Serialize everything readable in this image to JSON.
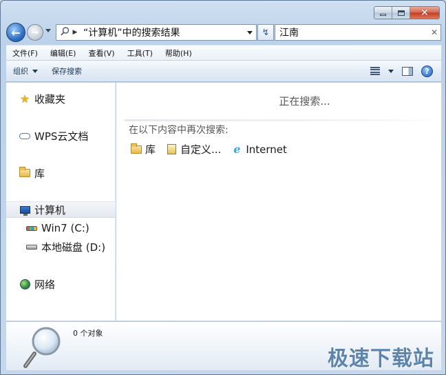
{
  "window": {
    "caption": {
      "minimize": "minimize",
      "maximize": "maximize",
      "close": "✕"
    }
  },
  "navbar": {
    "address_text": "“计算机”中的搜索结果",
    "search_value": "江南",
    "search_clear": "✕",
    "refresh_symbol": "↯"
  },
  "menu": {
    "items": [
      "文件(F)",
      "编辑(E)",
      "查看(V)",
      "工具(T)",
      "帮助(H)"
    ]
  },
  "commands": {
    "organize": "组织",
    "save_search": "保存搜索",
    "help": "?"
  },
  "navpane": {
    "favorites": "收藏夹",
    "wps_cloud": "WPS云文档",
    "library": "库",
    "computer": "计算机",
    "drive_c": "Win7 (C:)",
    "drive_d": "本地磁盘 (D:)",
    "network": "网络"
  },
  "content": {
    "status": "正在搜索...",
    "search_again_label": "在以下内容中再次搜索:",
    "scopes": {
      "library": "库",
      "custom": "自定义...",
      "internet": "Internet"
    }
  },
  "details": {
    "object_count": "0 个对象"
  },
  "watermark": "极速下载站",
  "colors": {
    "frame": "#c4d7ec",
    "pane_bg": "#ffffff",
    "accent": "#2f6fc3",
    "close_red": "#c23d22"
  },
  "icons": {
    "favorites": "star-icon",
    "wps_cloud": "cloud-icon",
    "library": "library-folder-icon",
    "computer": "computer-icon",
    "drive_c": "windows-drive-icon",
    "drive_d": "hard-drive-icon",
    "network": "network-globe-icon",
    "custom_scope": "custom-document-icon",
    "internet_scope": "internet-explorer-icon",
    "details": "magnifier-icon"
  }
}
